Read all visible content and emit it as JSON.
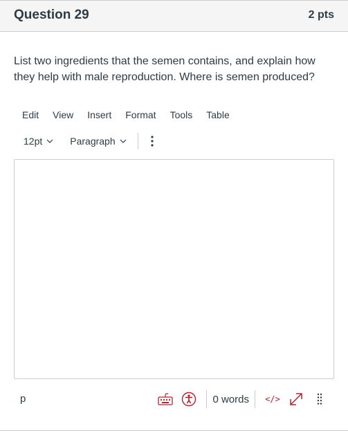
{
  "question": {
    "title": "Question 29",
    "points": "2 pts",
    "text": "List two ingredients that the semen contains, and explain how they help with male reproduction. Where is semen produced?"
  },
  "editor": {
    "menu": [
      "Edit",
      "View",
      "Insert",
      "Format",
      "Tools",
      "Table"
    ],
    "font_size": "12pt",
    "block_format": "Paragraph",
    "content": "",
    "status": {
      "path": "p",
      "word_count": "0 words",
      "html_toggle": "</>"
    }
  },
  "colors": {
    "accent": "#b5202e",
    "text": "#2d3b45",
    "border": "#c7cdd1",
    "header_bg": "#f5f5f5"
  },
  "icons": [
    "chevron-down-icon",
    "more-vertical-icon",
    "keyboard-icon",
    "accessibility-icon",
    "fullscreen-icon",
    "resize-handle-icon"
  ]
}
